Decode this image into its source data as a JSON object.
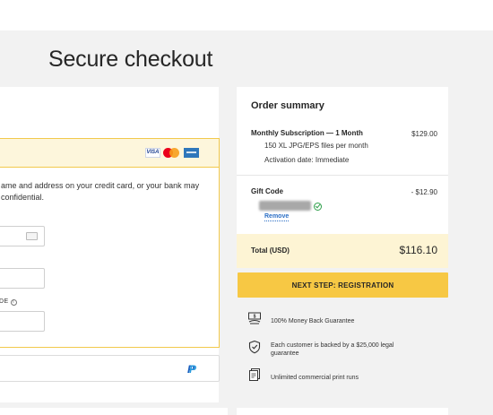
{
  "page": {
    "title": "Secure checkout"
  },
  "payment": {
    "card_brands": [
      "visa-icon",
      "mastercard-icon",
      "amex-icon"
    ],
    "visa_text": "VISA",
    "notice": "ame and address on your credit card, or your bank may\nconfidential.",
    "cvc_label_suffix": "DE",
    "paypal_text_a": "P",
    "paypal_text_b": "P"
  },
  "summary": {
    "title": "Order summary",
    "plan_name": "Monthly Subscription — 1 Month",
    "plan_price": "$129.00",
    "plan_detail_1": "150 XL JPG/EPS files per month",
    "plan_detail_2": "Activation date: Immediate",
    "gift_label": "Gift Code",
    "gift_amount": "- $12.90",
    "remove_label": "Remove",
    "total_label": "Total (USD)",
    "total_value": "$116.10"
  },
  "next_button": "NEXT STEP: REGISTRATION",
  "perks": [
    {
      "icon": "money-back-icon",
      "text": "100% Money Back Guarantee"
    },
    {
      "icon": "shield-icon",
      "text": "Each customer is backed by a $25,000 legal guarantee"
    },
    {
      "icon": "print-runs-icon",
      "text": "Unlimited commercial print runs"
    }
  ],
  "colors": {
    "accent": "#f7c844",
    "link": "#2c6fc5",
    "success": "#2e9f4a",
    "highlight_bg": "#fdf4d4"
  }
}
